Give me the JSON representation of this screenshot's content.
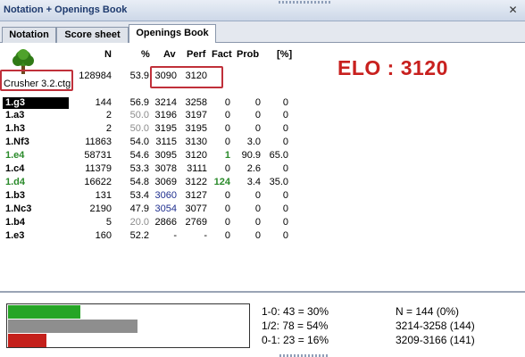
{
  "window": {
    "title": "Notation + Openings Book",
    "close_icon": "close-icon"
  },
  "tabs": [
    {
      "label": "Notation",
      "active": false
    },
    {
      "label": "Score sheet",
      "active": false
    },
    {
      "label": "Openings Book",
      "active": true
    }
  ],
  "columns": [
    "N",
    "%",
    "Av",
    "Perf",
    "Fact",
    "Prob",
    "[%]"
  ],
  "book": {
    "icon": "tree-icon",
    "name": "Crusher 3.2.ctg",
    "n": "128984",
    "pct": "53.9",
    "av": "3090",
    "perf": "3120"
  },
  "elo_label": "ELO : 3120",
  "moves": [
    {
      "move": "1.g3",
      "n": "144",
      "pct": "56.9",
      "av": "3214",
      "perf": "3258",
      "fact": "0",
      "prob": "0",
      "pctw": "0",
      "selected": true
    },
    {
      "move": "1.a3",
      "n": "2",
      "pct": "50.0",
      "av": "3196",
      "perf": "3197",
      "fact": "0",
      "prob": "0",
      "pctw": "0",
      "pct_style": "grey"
    },
    {
      "move": "1.h3",
      "n": "2",
      "pct": "50.0",
      "av": "3195",
      "perf": "3195",
      "fact": "0",
      "prob": "0",
      "pctw": "0",
      "pct_style": "grey"
    },
    {
      "move": "1.Nf3",
      "n": "11863",
      "pct": "54.0",
      "av": "3115",
      "perf": "3130",
      "fact": "0",
      "prob": "3.0",
      "pctw": "0"
    },
    {
      "move": "1.e4",
      "n": "58731",
      "pct": "54.6",
      "av": "3095",
      "perf": "3120",
      "fact": "1",
      "prob": "90.9",
      "pctw": "65.0",
      "move_style": "green",
      "fact_style": "green"
    },
    {
      "move": "1.c4",
      "n": "11379",
      "pct": "53.3",
      "av": "3078",
      "perf": "3111",
      "fact": "0",
      "prob": "2.6",
      "pctw": "0"
    },
    {
      "move": "1.d4",
      "n": "16622",
      "pct": "54.8",
      "av": "3069",
      "perf": "3122",
      "fact": "124",
      "prob": "3.4",
      "pctw": "35.0",
      "move_style": "green",
      "fact_style": "green"
    },
    {
      "move": "1.b3",
      "n": "131",
      "pct": "53.4",
      "av": "3060",
      "perf": "3127",
      "fact": "0",
      "prob": "0",
      "pctw": "0",
      "av_style": "blue"
    },
    {
      "move": "1.Nc3",
      "n": "2190",
      "pct": "47.9",
      "av": "3054",
      "perf": "3077",
      "fact": "0",
      "prob": "0",
      "pctw": "0",
      "av_style": "blue"
    },
    {
      "move": "1.b4",
      "n": "5",
      "pct": "20.0",
      "av": "2866",
      "perf": "2769",
      "fact": "0",
      "prob": "0",
      "pctw": "0",
      "pct_style": "grey"
    },
    {
      "move": "1.e3",
      "n": "160",
      "pct": "52.2",
      "av": "-",
      "perf": "-",
      "fact": "0",
      "prob": "0",
      "pctw": "0"
    }
  ],
  "summary": {
    "bars": [
      {
        "name": "white-wins-bar",
        "fraction": 0.3,
        "color": "#26a526"
      },
      {
        "name": "draws-bar",
        "fraction": 0.54,
        "color": "#8e8e8e"
      },
      {
        "name": "black-wins-bar",
        "fraction": 0.16,
        "color": "#c4201b"
      }
    ],
    "results": [
      "1-0: 43 = 30%",
      "1/2: 78 = 54%",
      "0-1: 23 = 16%"
    ],
    "totals": [
      "N = 144 (0%)",
      "3214-3258 (144)",
      "3209-3166 (141)"
    ]
  }
}
